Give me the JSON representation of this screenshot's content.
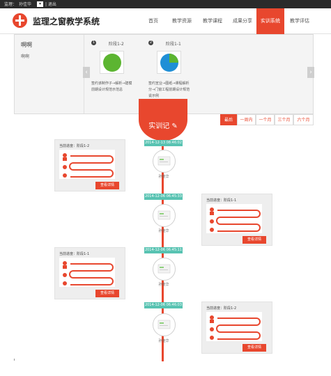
{
  "topbar": {
    "user_label": "监理：",
    "user_name": "孙佳华",
    "dropdown_glyph": "▾",
    "logout": "| 退出"
  },
  "brand": {
    "title": "监理之窗教学系统",
    "accent": "#e8472e"
  },
  "nav": {
    "items": [
      "首页",
      "教学资源",
      "教学课程",
      "成果分享",
      "实训系统",
      "教学评估"
    ],
    "active_index": 4
  },
  "dropdown": {
    "title": "啊啊",
    "subtitle": "啊啊",
    "cards": [
      {
        "number": "1",
        "label": "阶段1-2",
        "description_line1": "签约该制作子→解析→建模",
        "description_line2": "前期设计规范示范总",
        "pie": "green"
      },
      {
        "number": "2",
        "label": "阶段1-1",
        "description_line1": "签约宣业→图纸→课程解析",
        "description_line2": "分→门窗工程前期设计规范",
        "description_line3": "说示例",
        "pie": "blue-green"
      }
    ],
    "arrow_left": "‹",
    "arrow_right": "›"
  },
  "filters": {
    "items": [
      "最后",
      "一周内",
      "一个月",
      "三个月",
      "六个月"
    ],
    "active_index": 0
  },
  "hero": {
    "label": "实训记",
    "icon": "pencil-icon"
  },
  "timeline": [
    {
      "date": "2014-12-13 08:46:02",
      "name": "孙佳华"
    },
    {
      "date": "2014-12-06 06:45:33",
      "name": "孙佳华"
    },
    {
      "date": "2014-12-06 06:45:11",
      "name": "孙佳华"
    },
    {
      "date": "2014-12-06 06:46:03",
      "name": "孙佳华"
    }
  ],
  "posts": [
    {
      "title": "当前进度：阶段1-2",
      "button": "查看详情"
    },
    {
      "title": "当前进度：阶段1-1",
      "button": "查看详情"
    },
    {
      "title": "当前进度：阶段1-1",
      "button": "查看详情"
    },
    {
      "title": "当前进度：阶段1-2",
      "button": "查看详情"
    }
  ]
}
